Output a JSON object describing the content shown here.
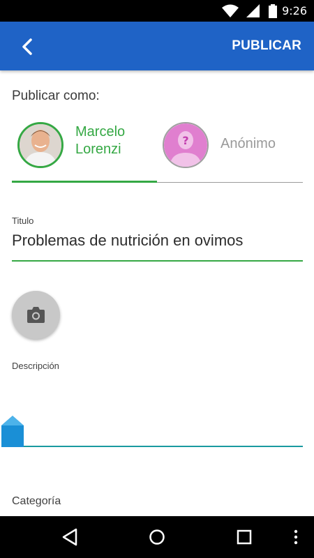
{
  "status_bar": {
    "time": "9:26",
    "icons": [
      "wifi-icon",
      "signal-icon",
      "battery-icon"
    ]
  },
  "app_bar": {
    "back_icon": "back-arrow-icon",
    "publish_label": "PUBLICAR",
    "color": "#1f63c6"
  },
  "form": {
    "publish_as_label": "Publicar como:",
    "options": [
      {
        "name": "Marcelo Lorenzi",
        "selected": true
      },
      {
        "name": "Anónimo",
        "selected": false
      }
    ],
    "title_label": "Titulo",
    "title_value": "Problemas de nutrición en ovimos",
    "camera_icon": "camera-icon",
    "description_label": "Descripción",
    "description_value": "",
    "category_label": "Categoría",
    "accent_color": "#35a844"
  },
  "nav_bar": {
    "buttons": [
      "back-nav-icon",
      "home-nav-icon",
      "recents-nav-icon",
      "more-nav-icon"
    ]
  }
}
